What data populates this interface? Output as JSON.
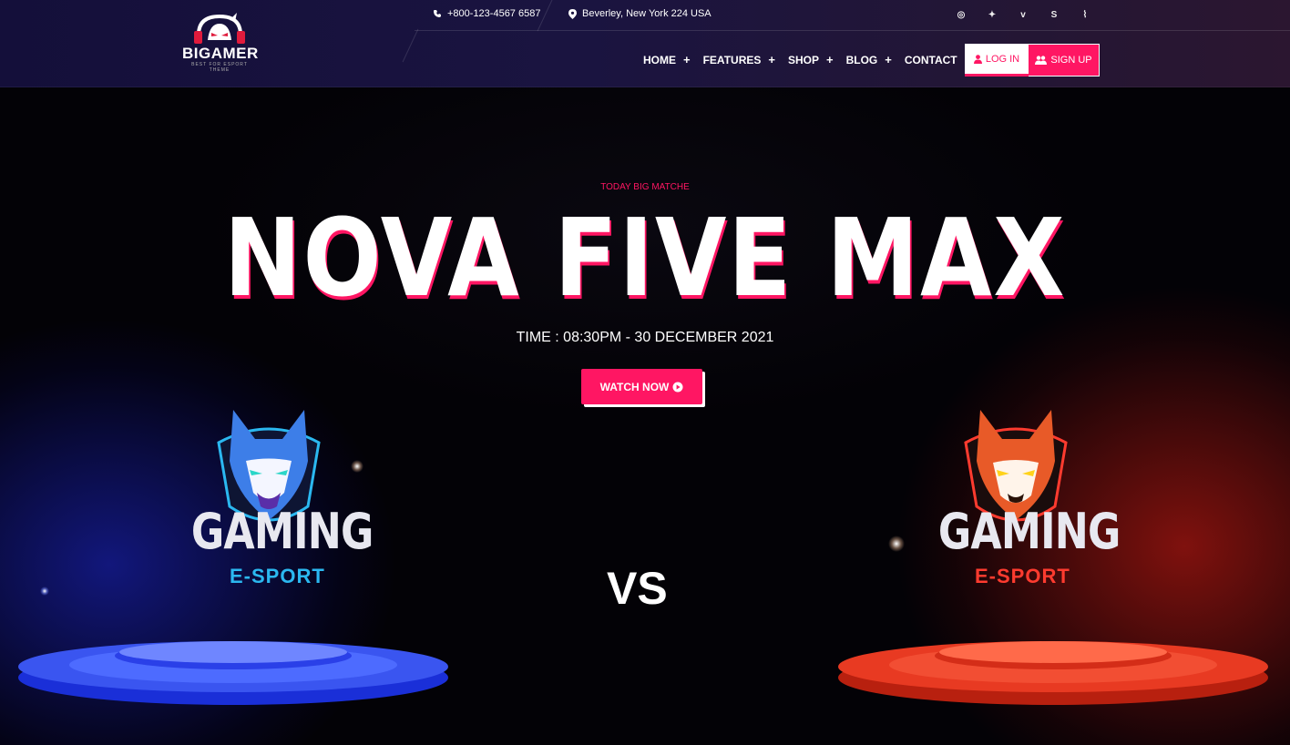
{
  "brand": {
    "name": "BIGAMER",
    "tagline": "BEST FOR ESPORT THEME"
  },
  "contact": {
    "phone": "+800-123-4567 6587",
    "address": "Beverley, New York 224 USA"
  },
  "social": [
    {
      "icon": "dribbble-icon",
      "glyph": "◎"
    },
    {
      "icon": "twitter-icon",
      "glyph": "✦"
    },
    {
      "icon": "vimeo-icon",
      "glyph": "v"
    },
    {
      "icon": "skype-icon",
      "glyph": "S"
    },
    {
      "icon": "rss-icon",
      "glyph": "⌇"
    }
  ],
  "nav": {
    "home": "HOME",
    "features": "FEATURES",
    "shop": "SHOP",
    "blog": "BLOG",
    "contact": "CONTACT",
    "plus": "+"
  },
  "auth": {
    "login": "LOG IN",
    "signup": "SIGN UP"
  },
  "hero": {
    "kicker": "TODAY BIG MATCHE",
    "title": "NOVA FIVE MAX",
    "time": "TIME : 08:30PM - 30 DECEMBER 2021",
    "watch": "WATCH NOW",
    "vs": "VS"
  },
  "teams": {
    "left": {
      "name": "GAMING",
      "sub": "E-SPORT",
      "accent": "#2bb8f0"
    },
    "right": {
      "name": "GAMING",
      "sub": "E-SPORT",
      "accent": "#ff3b2f"
    }
  },
  "colors": {
    "accent": "#ff1663",
    "header_bg": "#1a1440"
  }
}
